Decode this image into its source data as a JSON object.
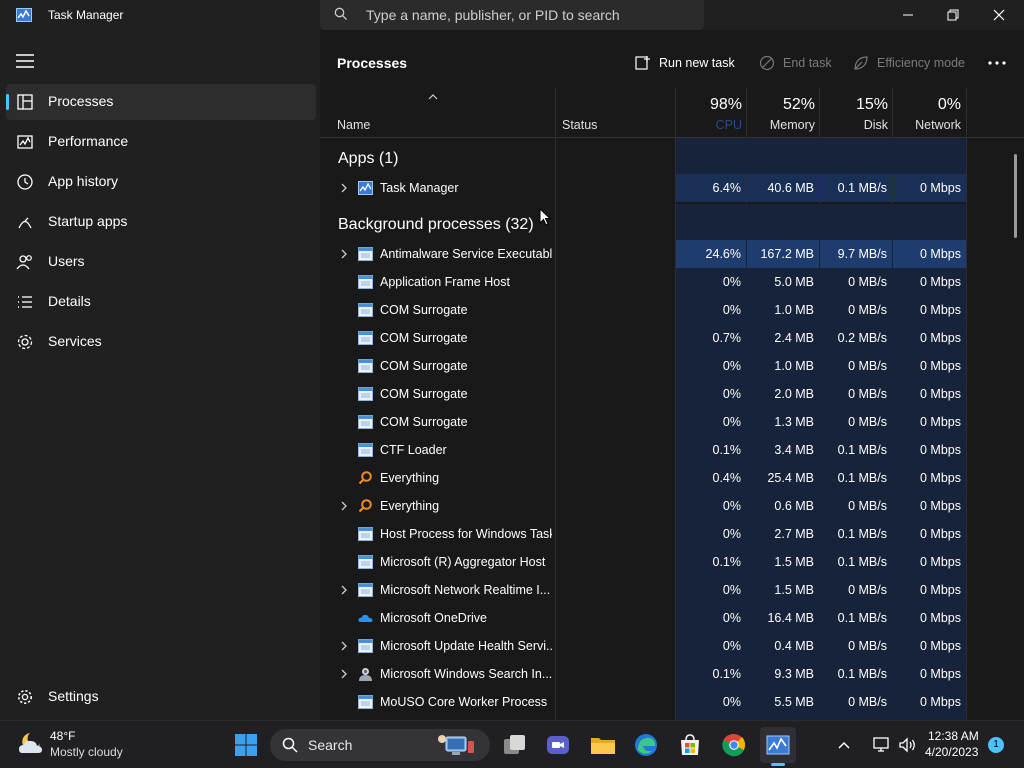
{
  "window": {
    "title": "Task Manager"
  },
  "search": {
    "placeholder": "Type a name, publisher, or PID to search"
  },
  "sidebar": {
    "items": [
      {
        "label": "Processes",
        "icon": "processes-icon",
        "active": true
      },
      {
        "label": "Performance",
        "icon": "performance-icon"
      },
      {
        "label": "App history",
        "icon": "app-history-icon"
      },
      {
        "label": "Startup apps",
        "icon": "startup-apps-icon"
      },
      {
        "label": "Users",
        "icon": "users-icon"
      },
      {
        "label": "Details",
        "icon": "details-icon"
      },
      {
        "label": "Services",
        "icon": "services-icon"
      }
    ],
    "settings_label": "Settings"
  },
  "main": {
    "title": "Processes",
    "toolbar": {
      "run_new_task": "Run new task",
      "end_task": "End task",
      "efficiency_mode": "Efficiency mode"
    },
    "columns": {
      "name": "Name",
      "status": "Status",
      "cpu": {
        "pct": "98%",
        "label": "CPU"
      },
      "memory": {
        "pct": "52%",
        "label": "Memory"
      },
      "disk": {
        "pct": "15%",
        "label": "Disk"
      },
      "network": {
        "pct": "0%",
        "label": "Network"
      }
    },
    "apps_group": "Apps (1)",
    "apps": [
      {
        "name": "Task Manager",
        "icon": "taskmanager",
        "expandable": true,
        "cpu": "6.4%",
        "mem": "40.6 MB",
        "disk": "0.1 MB/s",
        "net": "0 Mbps",
        "heat": 1
      }
    ],
    "bg_group": "Background processes (32)",
    "background": [
      {
        "name": "Antimalware Service Executable",
        "icon": "window",
        "expandable": true,
        "cpu": "24.6%",
        "mem": "167.2 MB",
        "disk": "9.7 MB/s",
        "net": "0 Mbps",
        "heat": 2
      },
      {
        "name": "Application Frame Host",
        "icon": "window",
        "expandable": false,
        "cpu": "0%",
        "mem": "5.0 MB",
        "disk": "0 MB/s",
        "net": "0 Mbps",
        "heat": 0
      },
      {
        "name": "COM Surrogate",
        "icon": "window",
        "expandable": false,
        "cpu": "0%",
        "mem": "1.0 MB",
        "disk": "0 MB/s",
        "net": "0 Mbps",
        "heat": 0
      },
      {
        "name": "COM Surrogate",
        "icon": "window",
        "expandable": false,
        "cpu": "0.7%",
        "mem": "2.4 MB",
        "disk": "0.2 MB/s",
        "net": "0 Mbps",
        "heat": 0
      },
      {
        "name": "COM Surrogate",
        "icon": "window",
        "expandable": false,
        "cpu": "0%",
        "mem": "1.0 MB",
        "disk": "0 MB/s",
        "net": "0 Mbps",
        "heat": 0
      },
      {
        "name": "COM Surrogate",
        "icon": "window",
        "expandable": false,
        "cpu": "0%",
        "mem": "2.0 MB",
        "disk": "0 MB/s",
        "net": "0 Mbps",
        "heat": 0
      },
      {
        "name": "COM Surrogate",
        "icon": "window",
        "expandable": false,
        "cpu": "0%",
        "mem": "1.3 MB",
        "disk": "0 MB/s",
        "net": "0 Mbps",
        "heat": 0
      },
      {
        "name": "CTF Loader",
        "icon": "window",
        "expandable": false,
        "cpu": "0.1%",
        "mem": "3.4 MB",
        "disk": "0.1 MB/s",
        "net": "0 Mbps",
        "heat": 0
      },
      {
        "name": "Everything",
        "icon": "everything",
        "expandable": false,
        "cpu": "0.4%",
        "mem": "25.4 MB",
        "disk": "0.1 MB/s",
        "net": "0 Mbps",
        "heat": 0
      },
      {
        "name": "Everything",
        "icon": "everything",
        "expandable": true,
        "cpu": "0%",
        "mem": "0.6 MB",
        "disk": "0 MB/s",
        "net": "0 Mbps",
        "heat": 0
      },
      {
        "name": "Host Process for Windows Tasks",
        "icon": "window",
        "expandable": false,
        "cpu": "0%",
        "mem": "2.7 MB",
        "disk": "0.1 MB/s",
        "net": "0 Mbps",
        "heat": 0
      },
      {
        "name": "Microsoft (R) Aggregator Host",
        "icon": "window",
        "expandable": false,
        "cpu": "0.1%",
        "mem": "1.5 MB",
        "disk": "0.1 MB/s",
        "net": "0 Mbps",
        "heat": 0
      },
      {
        "name": "Microsoft Network Realtime I...",
        "icon": "window",
        "expandable": true,
        "cpu": "0%",
        "mem": "1.5 MB",
        "disk": "0 MB/s",
        "net": "0 Mbps",
        "heat": 0
      },
      {
        "name": "Microsoft OneDrive",
        "icon": "onedrive",
        "expandable": false,
        "cpu": "0%",
        "mem": "16.4 MB",
        "disk": "0.1 MB/s",
        "net": "0 Mbps",
        "heat": 0
      },
      {
        "name": "Microsoft Update Health Servi...",
        "icon": "window",
        "expandable": true,
        "cpu": "0%",
        "mem": "0.4 MB",
        "disk": "0 MB/s",
        "net": "0 Mbps",
        "heat": 0
      },
      {
        "name": "Microsoft Windows Search In...",
        "icon": "searchindexer",
        "expandable": true,
        "cpu": "0.1%",
        "mem": "9.3 MB",
        "disk": "0.1 MB/s",
        "net": "0 Mbps",
        "heat": 0
      },
      {
        "name": "MoUSO Core Worker Process",
        "icon": "window",
        "expandable": false,
        "cpu": "0%",
        "mem": "5.5 MB",
        "disk": "0 MB/s",
        "net": "0 Mbps",
        "heat": 0
      }
    ]
  },
  "taskbar": {
    "weather_temp": "48°F",
    "weather_desc": "Mostly cloudy",
    "search_label": "Search",
    "time": "12:38 AM",
    "date": "4/20/2023",
    "notification_count": "1"
  }
}
